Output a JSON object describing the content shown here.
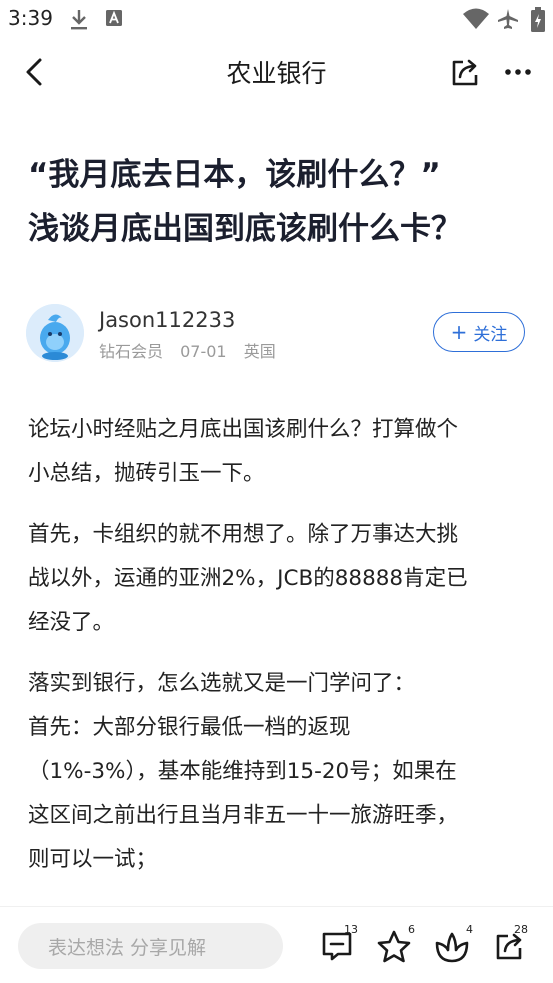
{
  "status_bar": {
    "time": "3:39",
    "icons": [
      "download-icon",
      "keyboard-icon",
      "wifi-icon",
      "airplane-icon",
      "battery-charging-icon"
    ]
  },
  "nav": {
    "title": "农业银行",
    "back_icon": "chevron-left-icon",
    "share_icon": "share-icon",
    "more_icon": "more-icon"
  },
  "article": {
    "title_lines": [
      "“我月底去日本，该刷什么？”",
      "浅谈月底出国到底该刷什么卡？"
    ],
    "author": {
      "name": "Jason112233",
      "level": "钻石会员",
      "date": "07-01",
      "location": "英国",
      "follow_label": "关注"
    },
    "paragraphs": [
      [
        "论坛小时经贴之月底出国该刷什么？打算做个",
        "小总结，抛砖引玉一下。"
      ],
      [
        "首先，卡组织的就不用想了。除了万事达大挑",
        "战以外，运通的亚洲2%，JCB的88888肯定已",
        "经没了。"
      ],
      [
        "落实到银行，怎么选就又是一门学问了：",
        "首先：大部分银行最低一档的返现",
        "（1%-3%），基本能维持到15-20号；如果在",
        "这区间之前出行且当月非五一十一旅游旺季，",
        "则可以一试；"
      ]
    ]
  },
  "bottom_bar": {
    "comment_placeholder": "表达想法 分享见解",
    "comment_count": "13",
    "favorite_count": "6",
    "like_count": "4",
    "share_count": "28"
  },
  "colors": {
    "accent": "#2e6fd8",
    "title": "#1b1f2e",
    "muted": "#9a9a9a",
    "input_bg": "#efefef"
  }
}
